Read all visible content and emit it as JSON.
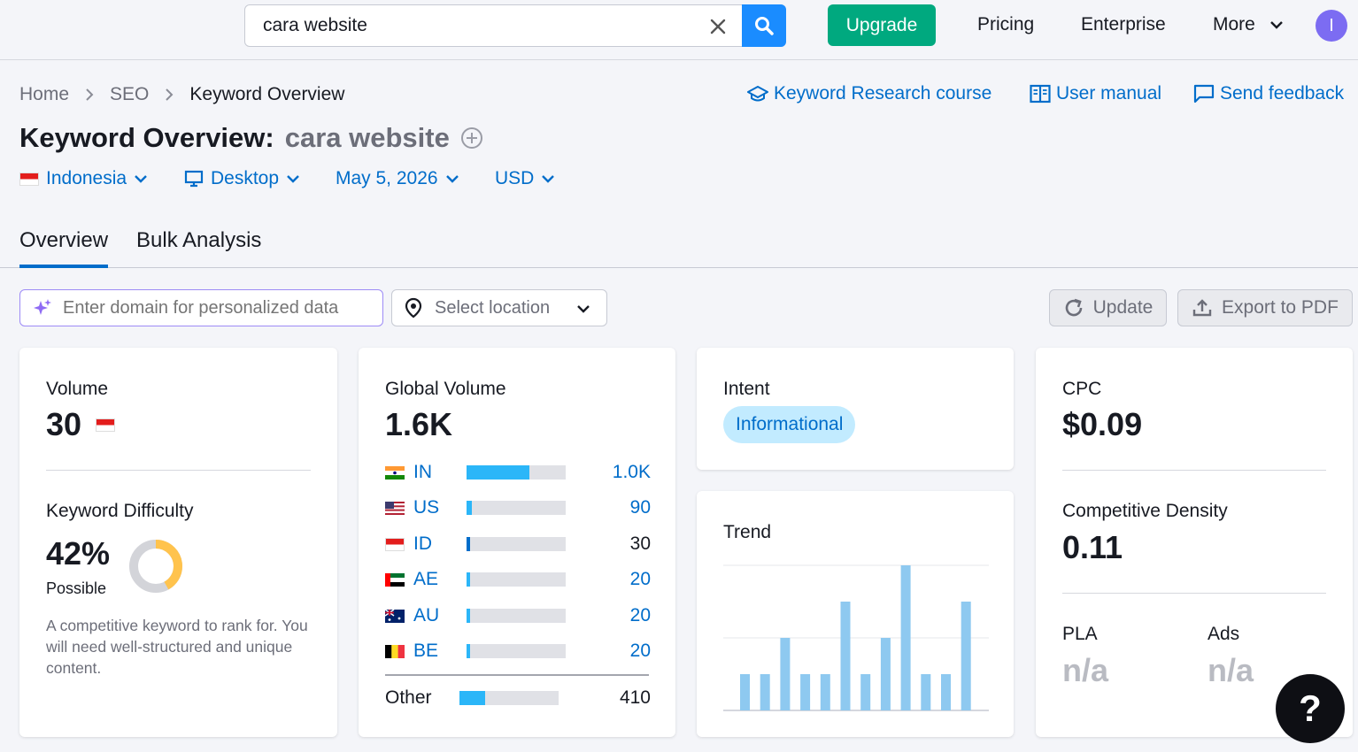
{
  "header": {
    "search_value": "cara website",
    "upgrade_label": "Upgrade",
    "nav": {
      "pricing": "Pricing",
      "enterprise": "Enterprise",
      "more": "More"
    },
    "avatar_initial": "I"
  },
  "breadcrumb": {
    "home": "Home",
    "seo": "SEO",
    "current": "Keyword Overview"
  },
  "help_links": {
    "course": "Keyword Research course",
    "manual": "User manual",
    "feedback": "Send feedback"
  },
  "page_title": {
    "prefix": "Keyword Overview:",
    "keyword": "cara website"
  },
  "filters": {
    "country": "Indonesia",
    "device": "Desktop",
    "date": "May 5, 2026",
    "currency": "USD"
  },
  "tabs": [
    "Overview",
    "Bulk Analysis"
  ],
  "toolbar": {
    "domain_placeholder": "Enter domain for personalized data",
    "location_placeholder": "Select location",
    "update_label": "Update",
    "export_label": "Export to PDF"
  },
  "volume_card": {
    "label": "Volume",
    "value": "30",
    "kd_label": "Keyword Difficulty",
    "kd_value": "42%",
    "kd_percent": 42,
    "kd_rating": "Possible",
    "kd_description": "A competitive keyword to rank for. You will need well-structured and unique content."
  },
  "global_volume": {
    "label": "Global Volume",
    "value": "1.6K",
    "countries": [
      {
        "code": "IN",
        "value": "1.0K",
        "share": 0.63
      },
      {
        "code": "US",
        "value": "90",
        "share": 0.05
      },
      {
        "code": "ID",
        "value": "30",
        "share": 0.03
      },
      {
        "code": "AE",
        "value": "20",
        "share": 0.03
      },
      {
        "code": "AU",
        "value": "20",
        "share": 0.03
      },
      {
        "code": "BE",
        "value": "20",
        "share": 0.03
      }
    ],
    "other": {
      "label": "Other",
      "value": "410",
      "share": 0.26
    }
  },
  "intent_card": {
    "label": "Intent",
    "value": "Informational"
  },
  "trend_card": {
    "label": "Trend",
    "values": [
      0.25,
      0.25,
      0.5,
      0.25,
      0.25,
      0.75,
      0.25,
      0.5,
      1.0,
      0.25,
      0.25,
      0.75
    ]
  },
  "cpc_card": {
    "label": "CPC",
    "value": "$0.09",
    "density_label": "Competitive Density",
    "density_value": "0.11",
    "pla_label": "PLA",
    "pla_value": "n/a",
    "ads_label": "Ads",
    "ads_value": "n/a"
  },
  "help_fab": "?",
  "colors": {
    "accent": "#006dca",
    "upgrade": "#00a97f",
    "search_button": "#1a8cff",
    "bar_fill": "#2bb6f8",
    "trend_bar": "#8ec9f0",
    "kd_ring": "#ffc34d"
  }
}
